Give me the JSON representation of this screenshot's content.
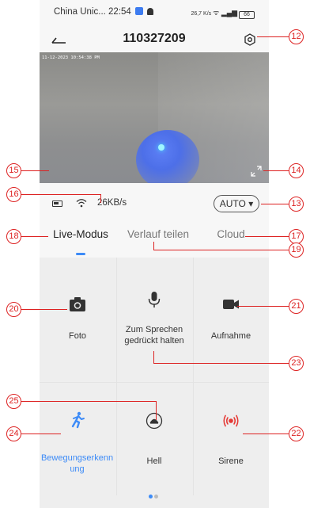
{
  "status_bar": {
    "carrier_time": "China Unic... 22:54",
    "net_speed_value": "26,7",
    "net_speed_unit": "K/s",
    "battery": "66"
  },
  "header": {
    "title": "110327209"
  },
  "video": {
    "timestamp": "11-12-2023 10:54:38 PM"
  },
  "info": {
    "speed": "26KB/s",
    "quality": "AUTO ▾"
  },
  "tabs": [
    {
      "label": "Live-Modus",
      "active": true
    },
    {
      "label": "Verlauf teilen",
      "active": false
    },
    {
      "label": "Cloud",
      "active": false
    }
  ],
  "actions": {
    "photo": "Foto",
    "talk": "Zum Sprechen gedrückt halten",
    "record": "Aufnahme",
    "motion": "Bewegungserkenn ung",
    "light": "Hell",
    "siren": "Sirene"
  },
  "callouts": [
    "12",
    "13",
    "14",
    "15",
    "16",
    "17",
    "18",
    "19",
    "20",
    "21",
    "22",
    "23",
    "24",
    "25"
  ],
  "colors": {
    "accent_blue": "#3d8bf7",
    "siren_red": "#e53935",
    "callout_red": "#d22222"
  },
  "pager": {
    "current": 1,
    "total": 2
  }
}
